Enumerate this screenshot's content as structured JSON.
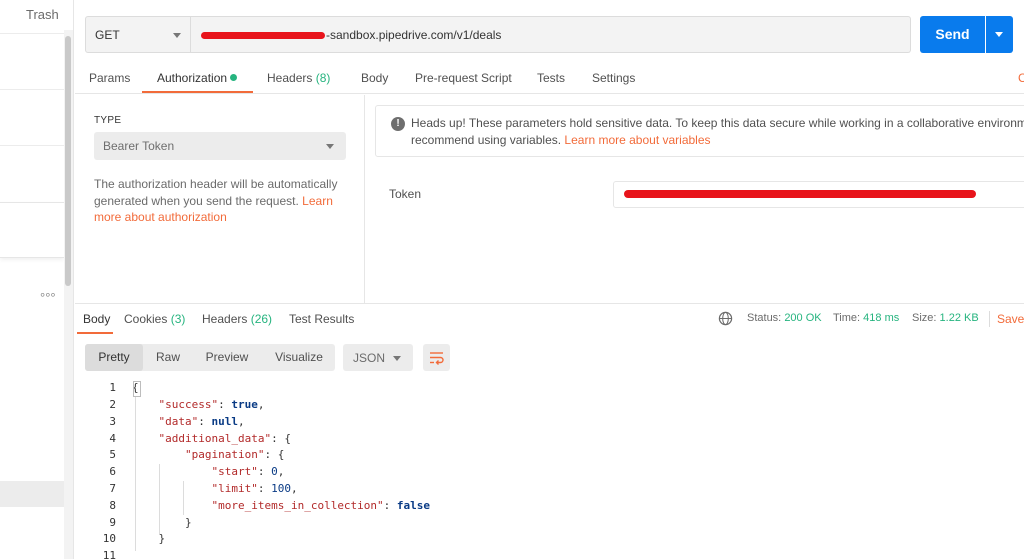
{
  "sidebar": {
    "trash_label": "Trash",
    "more_label": "°°°"
  },
  "request": {
    "method": "GET",
    "url_visible": "-sandbox.pipedrive.com/v1/deals",
    "send_label": "Send"
  },
  "request_tabs": [
    {
      "label": "Params"
    },
    {
      "label": "Authorization",
      "active": true
    },
    {
      "label": "Headers",
      "count": "(8)"
    },
    {
      "label": "Body"
    },
    {
      "label": "Pre-request Script"
    },
    {
      "label": "Tests"
    },
    {
      "label": "Settings"
    }
  ],
  "cut_off_right_label": "C",
  "auth": {
    "type_label": "TYPE",
    "type_value": "Bearer Token",
    "description": "The authorization header will be automatically generated when you send the request.",
    "learn_more_link": "Learn more about authorization",
    "notice_text_line1": "Heads up! These parameters hold sensitive data. To keep this data secure while working in a collaborative environmen",
    "notice_text_line2": "recommend using variables.",
    "notice_link": "Learn more about variables",
    "token_label": "Token"
  },
  "response_tabs": [
    {
      "label": "Body",
      "active": true
    },
    {
      "label": "Cookies",
      "count": "(3)"
    },
    {
      "label": "Headers",
      "count": "(26)"
    },
    {
      "label": "Test Results"
    }
  ],
  "status": {
    "status_label": "Status:",
    "status_value": "200 OK",
    "time_label": "Time:",
    "time_value": "418 ms",
    "size_label": "Size:",
    "size_value": "1.22 KB",
    "save_label": "Save"
  },
  "body_view": {
    "modes": [
      "Pretty",
      "Raw",
      "Preview",
      "Visualize"
    ],
    "active_mode": "Pretty",
    "format": "JSON"
  },
  "colors": {
    "accent": "#f26b3a",
    "send": "#097bed",
    "success": "#26b47f",
    "redaction": "#e8141b"
  },
  "icons": [
    "globe-icon",
    "warning-icon",
    "wrap-lines-icon",
    "chevron-down-icon"
  ],
  "code_lines": [
    {
      "n": "1",
      "text": "{"
    },
    {
      "n": "2",
      "key": "\"success\"",
      "rest": ": ",
      "value": "true",
      "tail": ","
    },
    {
      "n": "3",
      "key": "\"data\"",
      "rest": ": ",
      "value": "null",
      "tail": ","
    },
    {
      "n": "4",
      "key": "\"additional_data\"",
      "rest": ": {"
    },
    {
      "n": "5",
      "key": "\"pagination\"",
      "rest": ": {"
    },
    {
      "n": "6",
      "key": "\"start\"",
      "rest": ": ",
      "value": "0",
      "tail": ","
    },
    {
      "n": "7",
      "key": "\"limit\"",
      "rest": ": ",
      "value": "100",
      "tail": ","
    },
    {
      "n": "8",
      "key": "\"more_items_in_collection\"",
      "rest": ": ",
      "value": "false"
    },
    {
      "n": "9",
      "text": "}"
    },
    {
      "n": "10",
      "text": "}"
    },
    {
      "n": "11",
      "text": ""
    }
  ]
}
